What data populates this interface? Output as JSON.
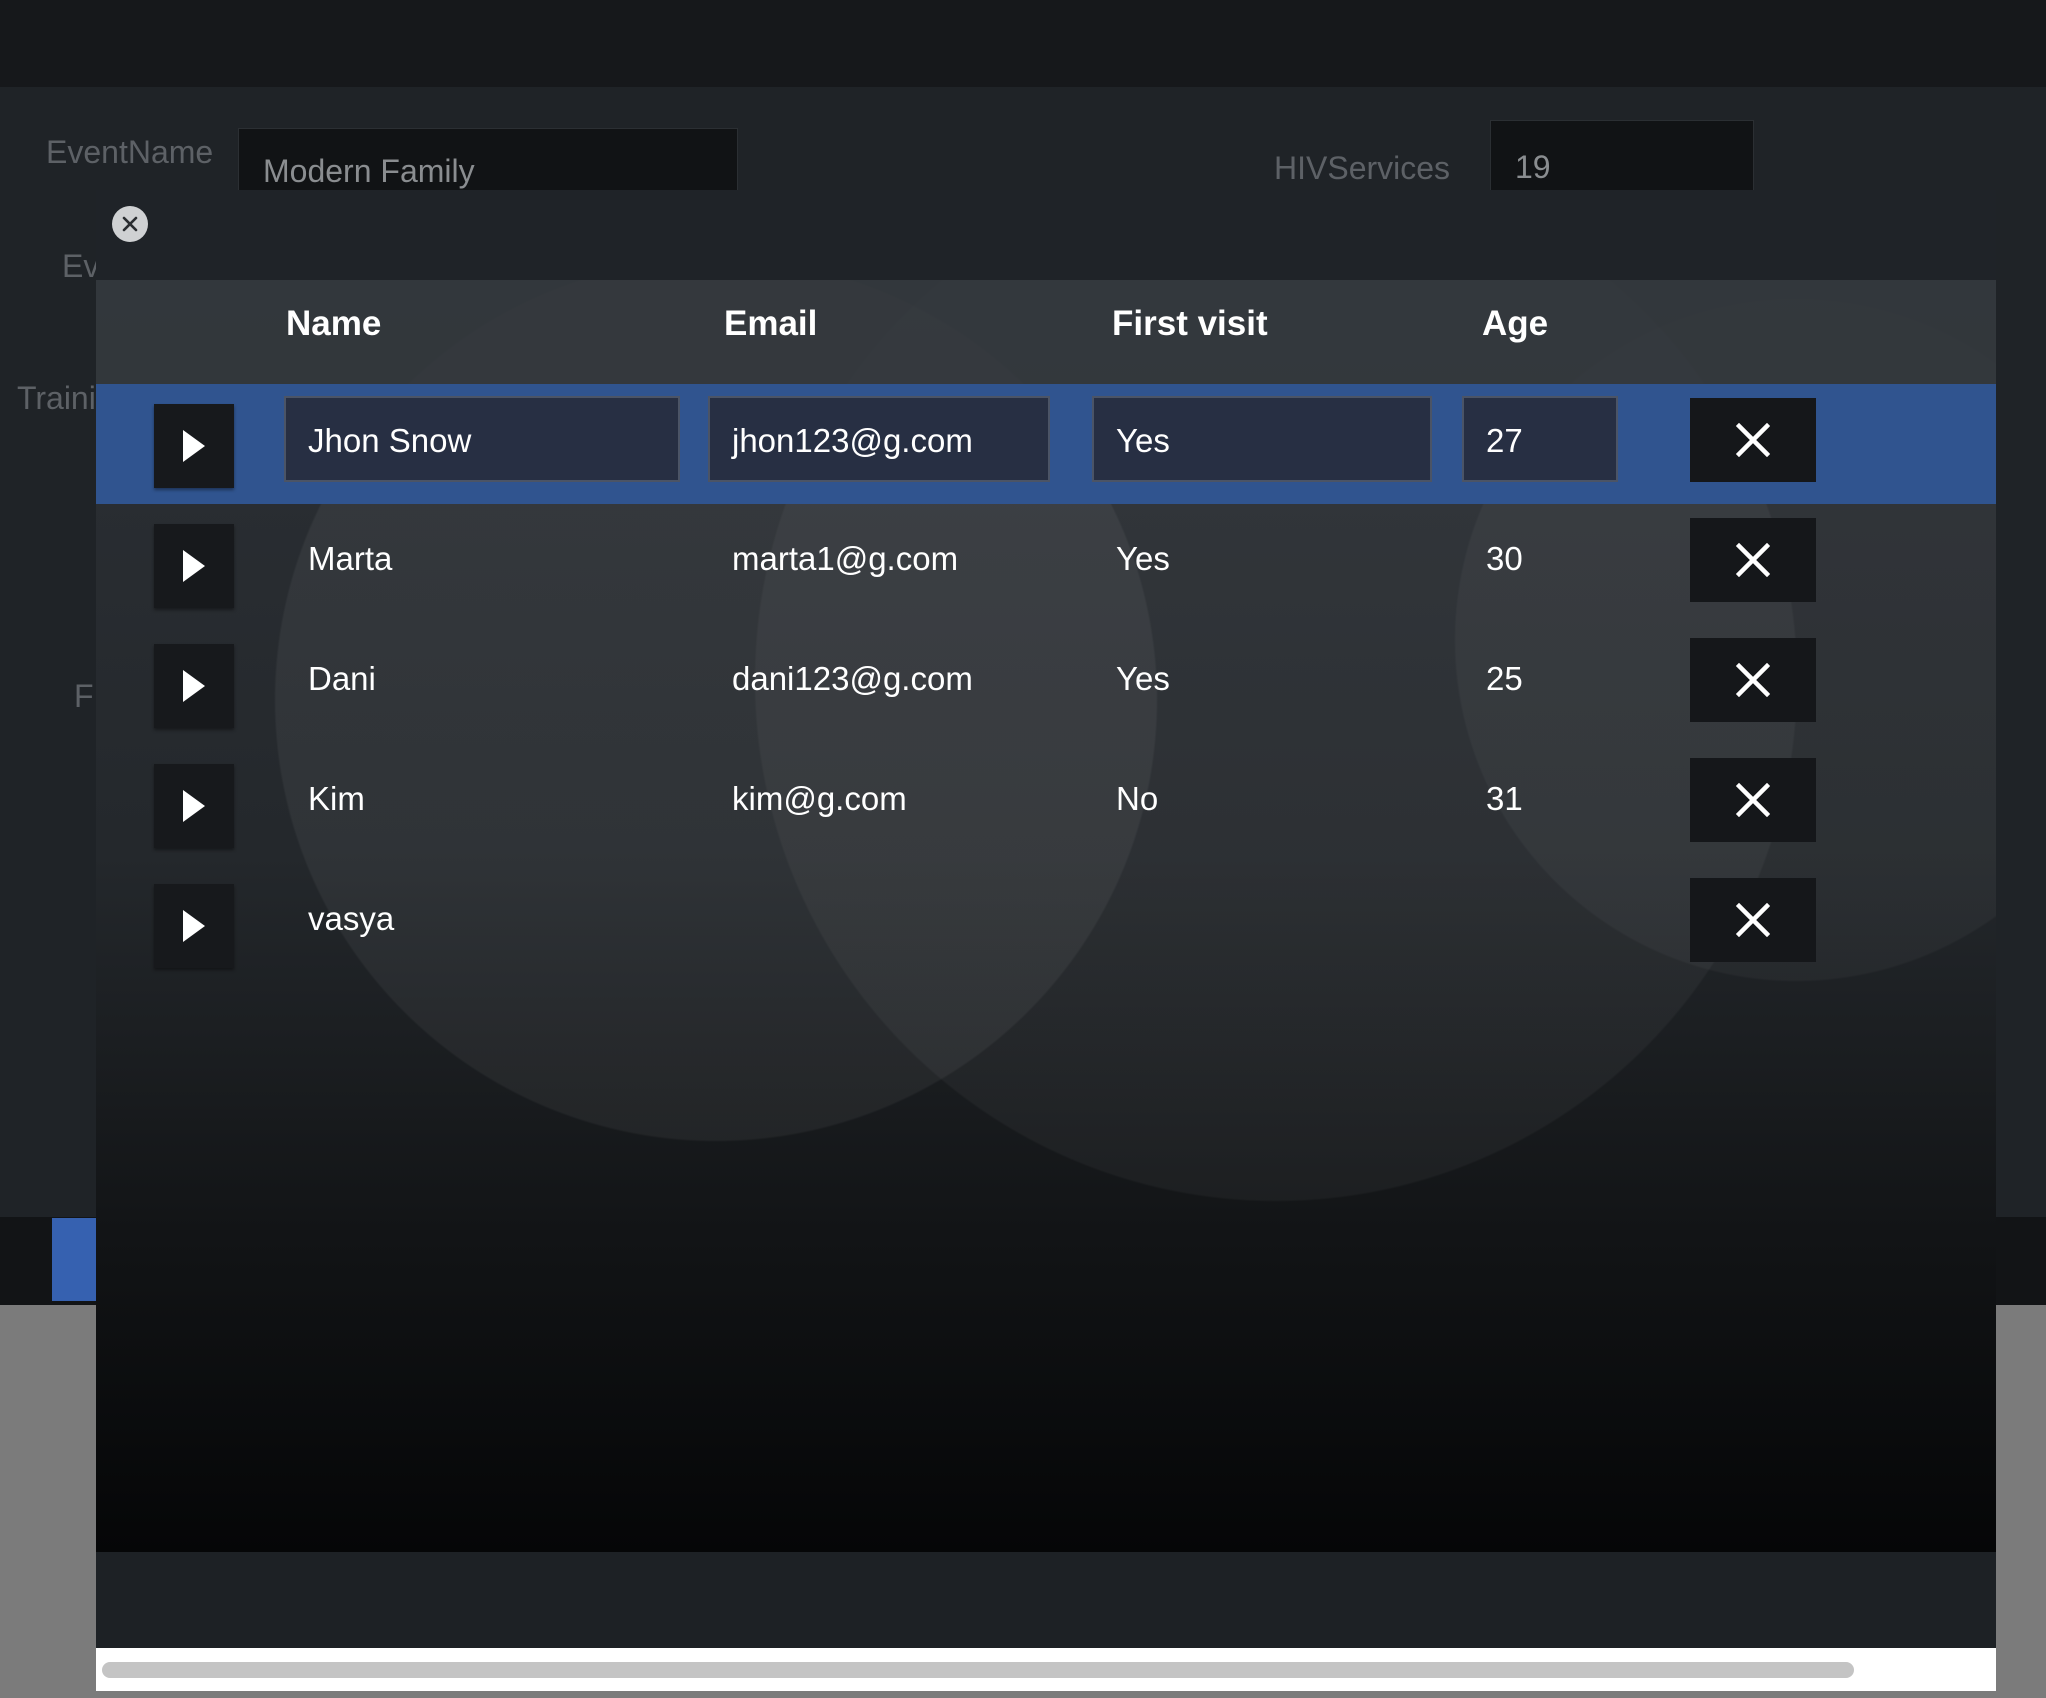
{
  "background_form": {
    "event_name_label": "EventName",
    "event_name_value": "Modern Family",
    "hiv_services_label": "HIVServices",
    "hiv_services_value": "19",
    "truncated_label_ev": "Ev",
    "truncated_label_train": "Traini",
    "truncated_label_f": "F"
  },
  "modal": {
    "columns": {
      "name": "Name",
      "email": "Email",
      "first_visit": "First visit",
      "age": "Age"
    },
    "rows": [
      {
        "name": "Jhon Snow",
        "email": "jhon123@g.com",
        "first_visit": "Yes",
        "age": "27",
        "selected": true
      },
      {
        "name": "Marta",
        "email": "marta1@g.com",
        "first_visit": "Yes",
        "age": "30",
        "selected": false
      },
      {
        "name": "Dani",
        "email": "dani123@g.com",
        "first_visit": "Yes",
        "age": "25",
        "selected": false
      },
      {
        "name": "Kim",
        "email": "kim@g.com",
        "first_visit": "No",
        "age": "31",
        "selected": false
      },
      {
        "name": "vasya",
        "email": "",
        "first_visit": "",
        "age": "",
        "selected": false
      }
    ]
  },
  "icons": {
    "close": "close-icon",
    "expand": "play-triangle-icon",
    "delete": "x-icon"
  },
  "colors": {
    "selected_row": "#30548f",
    "accent_button": "#3661b0"
  }
}
